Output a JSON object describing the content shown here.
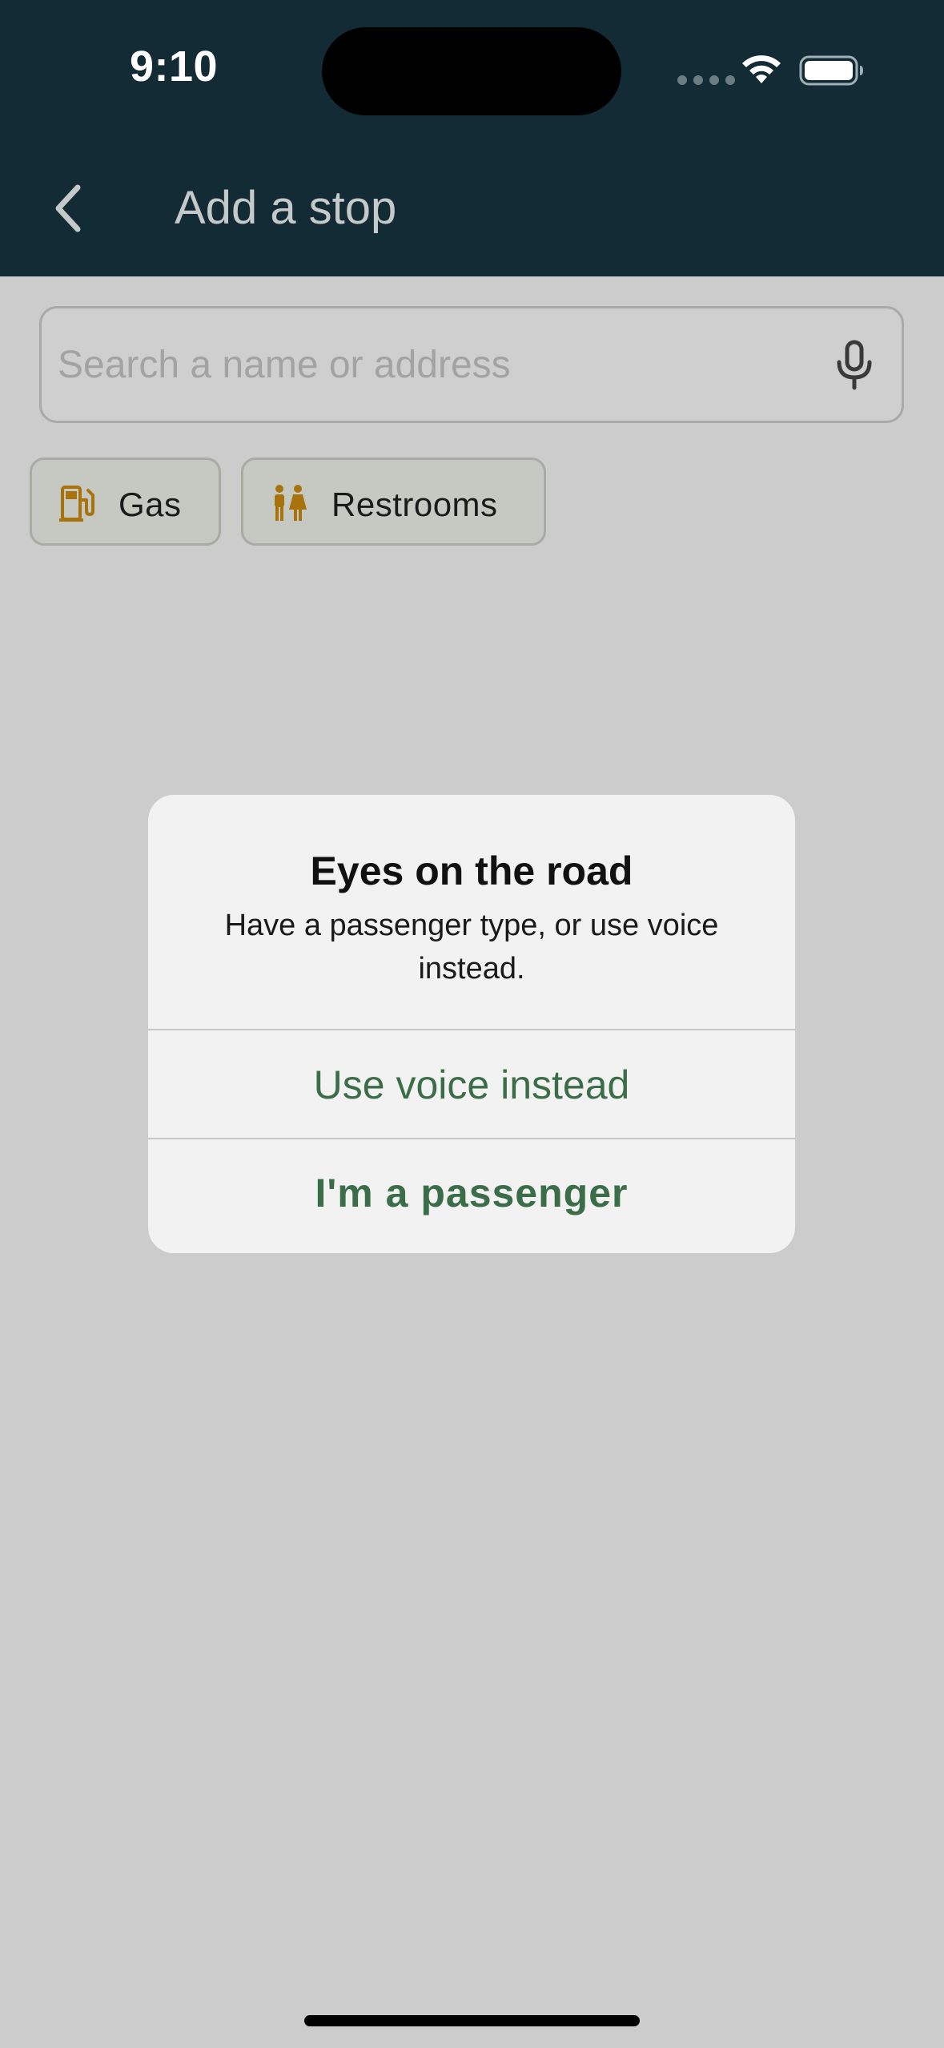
{
  "status_bar": {
    "time": "9:10"
  },
  "nav": {
    "title": "Add a stop",
    "back_icon": "chevron-left-icon"
  },
  "search": {
    "placeholder": "Search a name or address",
    "value": "",
    "mic_icon": "microphone-icon"
  },
  "chips": [
    {
      "label": "Gas",
      "icon": "gas-pump-icon"
    },
    {
      "label": "Restrooms",
      "icon": "restroom-icon"
    }
  ],
  "alert": {
    "title": "Eyes on the road",
    "message": "Have a passenger type, or use voice instead.",
    "buttons": [
      {
        "label": "Use voice instead"
      },
      {
        "label": "I'm a passenger"
      }
    ]
  },
  "colors": {
    "header_bg": "#132b35",
    "accent_green": "#3b6e48",
    "chip_icon": "#a8730c",
    "overlay_bg": "#cccccc"
  }
}
